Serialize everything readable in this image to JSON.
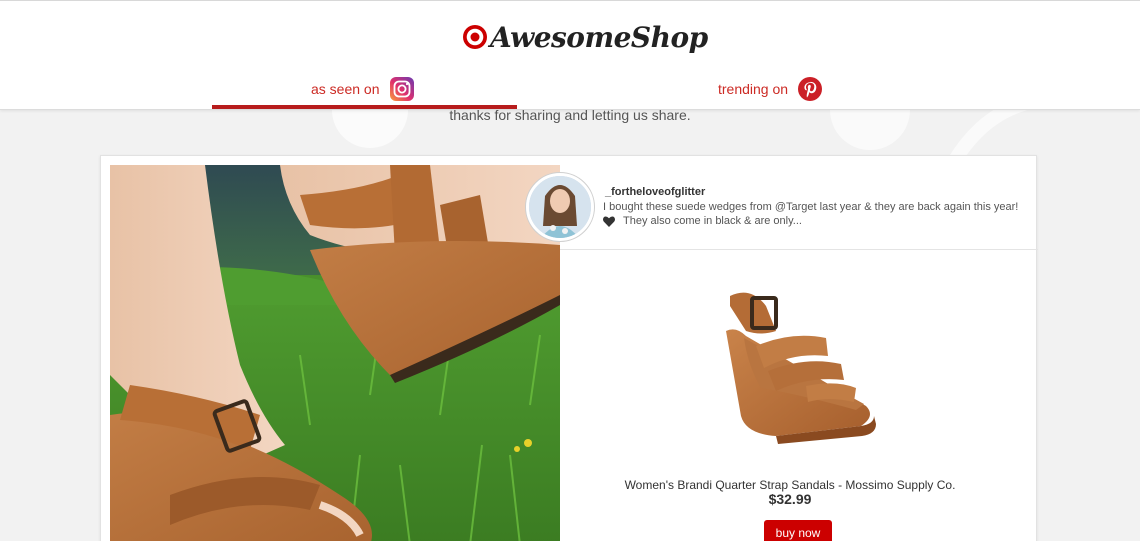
{
  "brand": {
    "name": "AwesomeShop",
    "colors": {
      "accent": "#cc2a24",
      "brand_red": "#cc0000",
      "background": "#f2f2f2"
    }
  },
  "tabs": [
    {
      "label": "as seen on",
      "icon": "instagram-icon",
      "active": true
    },
    {
      "label": "trending on",
      "icon": "pinterest-icon",
      "active": false
    }
  ],
  "subtitle": "thanks for sharing and letting us share.",
  "post": {
    "username": "_fortheloveofglitter",
    "caption_line1": "I bought these suede wedges from @Target last year & they are back again this year!",
    "caption_line2": "They also come in black & are only...",
    "caption_icon": "heart-icon"
  },
  "product": {
    "name": "Women's Brandi Quarter Strap Sandals - Mossimo Supply Co.",
    "price": "$32.99",
    "button_label": "buy now"
  }
}
